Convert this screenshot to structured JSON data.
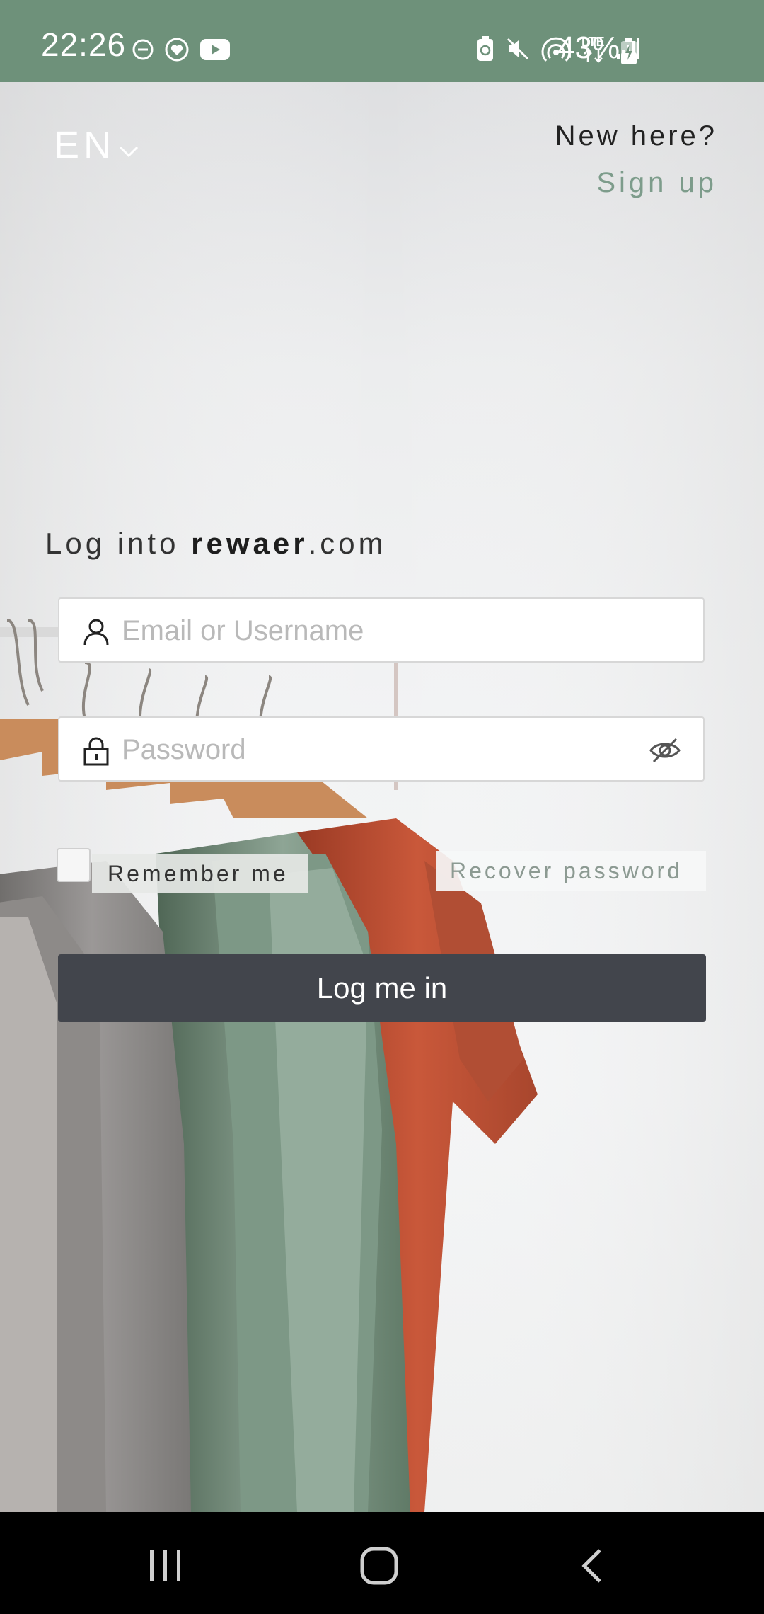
{
  "status_bar": {
    "time": "22:26",
    "battery_percent": "43%",
    "network": "LTE",
    "left_icons": [
      "do-not-disturb-icon",
      "heart-app-icon",
      "youtube-icon"
    ],
    "right_icons": [
      "battery-saver-icon",
      "mute-icon",
      "hotspot-icon",
      "lte-icon",
      "signal-icon",
      "battery-charging-icon"
    ]
  },
  "header": {
    "language": "EN",
    "new_here": "New here?",
    "signup": "Sign up"
  },
  "login": {
    "title_prefix": "Log into ",
    "title_brand": "rewaer",
    "title_suffix": ".com",
    "email_placeholder": "Email or Username",
    "password_placeholder": "Password",
    "remember_label": "Remember me",
    "remember_checked": false,
    "recover_label": "Recover password",
    "submit_label": "Log me in"
  },
  "nav_bar": {
    "buttons": [
      "recent-apps",
      "home",
      "back"
    ]
  },
  "colors": {
    "status_bar": "#6e917a",
    "accent": "#7d9c8b",
    "button": "#42454c"
  }
}
